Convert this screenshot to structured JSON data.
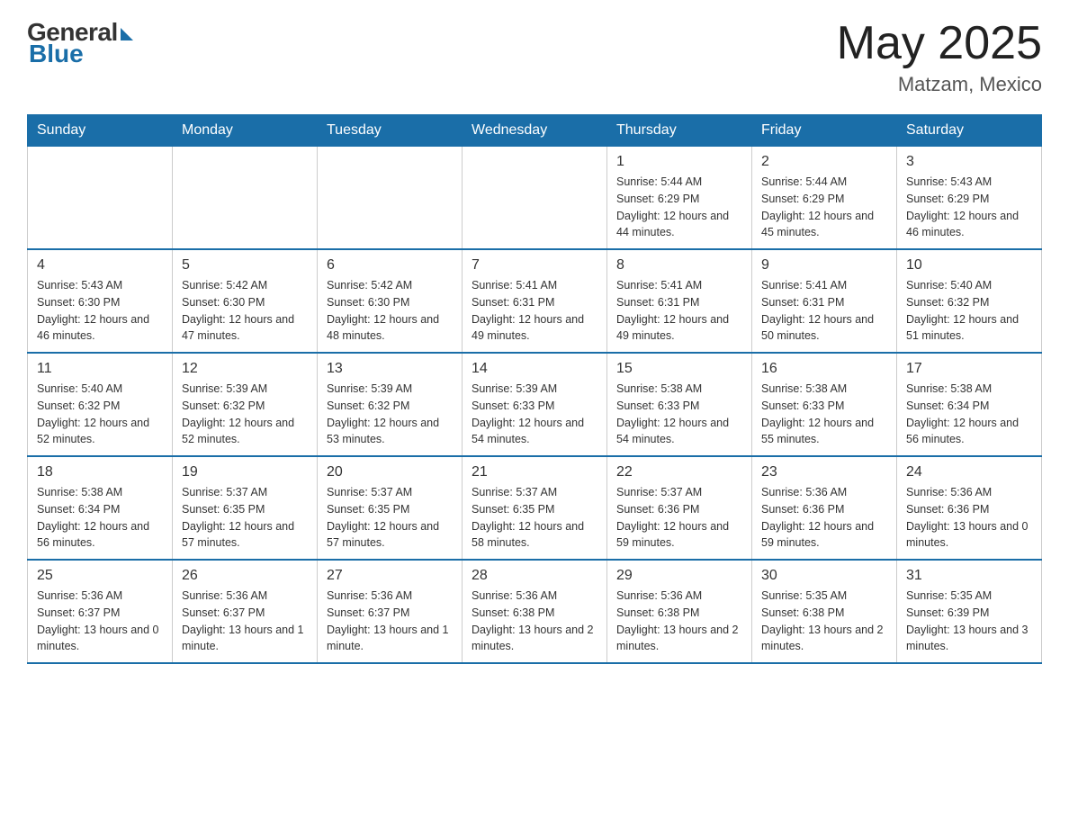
{
  "header": {
    "logo": {
      "general": "General",
      "blue": "Blue"
    },
    "title": "May 2025",
    "location": "Matzam, Mexico"
  },
  "days_of_week": [
    "Sunday",
    "Monday",
    "Tuesday",
    "Wednesday",
    "Thursday",
    "Friday",
    "Saturday"
  ],
  "weeks": [
    [
      {
        "day": "",
        "info": ""
      },
      {
        "day": "",
        "info": ""
      },
      {
        "day": "",
        "info": ""
      },
      {
        "day": "",
        "info": ""
      },
      {
        "day": "1",
        "info": "Sunrise: 5:44 AM\nSunset: 6:29 PM\nDaylight: 12 hours\nand 44 minutes."
      },
      {
        "day": "2",
        "info": "Sunrise: 5:44 AM\nSunset: 6:29 PM\nDaylight: 12 hours\nand 45 minutes."
      },
      {
        "day": "3",
        "info": "Sunrise: 5:43 AM\nSunset: 6:29 PM\nDaylight: 12 hours\nand 46 minutes."
      }
    ],
    [
      {
        "day": "4",
        "info": "Sunrise: 5:43 AM\nSunset: 6:30 PM\nDaylight: 12 hours\nand 46 minutes."
      },
      {
        "day": "5",
        "info": "Sunrise: 5:42 AM\nSunset: 6:30 PM\nDaylight: 12 hours\nand 47 minutes."
      },
      {
        "day": "6",
        "info": "Sunrise: 5:42 AM\nSunset: 6:30 PM\nDaylight: 12 hours\nand 48 minutes."
      },
      {
        "day": "7",
        "info": "Sunrise: 5:41 AM\nSunset: 6:31 PM\nDaylight: 12 hours\nand 49 minutes."
      },
      {
        "day": "8",
        "info": "Sunrise: 5:41 AM\nSunset: 6:31 PM\nDaylight: 12 hours\nand 49 minutes."
      },
      {
        "day": "9",
        "info": "Sunrise: 5:41 AM\nSunset: 6:31 PM\nDaylight: 12 hours\nand 50 minutes."
      },
      {
        "day": "10",
        "info": "Sunrise: 5:40 AM\nSunset: 6:32 PM\nDaylight: 12 hours\nand 51 minutes."
      }
    ],
    [
      {
        "day": "11",
        "info": "Sunrise: 5:40 AM\nSunset: 6:32 PM\nDaylight: 12 hours\nand 52 minutes."
      },
      {
        "day": "12",
        "info": "Sunrise: 5:39 AM\nSunset: 6:32 PM\nDaylight: 12 hours\nand 52 minutes."
      },
      {
        "day": "13",
        "info": "Sunrise: 5:39 AM\nSunset: 6:32 PM\nDaylight: 12 hours\nand 53 minutes."
      },
      {
        "day": "14",
        "info": "Sunrise: 5:39 AM\nSunset: 6:33 PM\nDaylight: 12 hours\nand 54 minutes."
      },
      {
        "day": "15",
        "info": "Sunrise: 5:38 AM\nSunset: 6:33 PM\nDaylight: 12 hours\nand 54 minutes."
      },
      {
        "day": "16",
        "info": "Sunrise: 5:38 AM\nSunset: 6:33 PM\nDaylight: 12 hours\nand 55 minutes."
      },
      {
        "day": "17",
        "info": "Sunrise: 5:38 AM\nSunset: 6:34 PM\nDaylight: 12 hours\nand 56 minutes."
      }
    ],
    [
      {
        "day": "18",
        "info": "Sunrise: 5:38 AM\nSunset: 6:34 PM\nDaylight: 12 hours\nand 56 minutes."
      },
      {
        "day": "19",
        "info": "Sunrise: 5:37 AM\nSunset: 6:35 PM\nDaylight: 12 hours\nand 57 minutes."
      },
      {
        "day": "20",
        "info": "Sunrise: 5:37 AM\nSunset: 6:35 PM\nDaylight: 12 hours\nand 57 minutes."
      },
      {
        "day": "21",
        "info": "Sunrise: 5:37 AM\nSunset: 6:35 PM\nDaylight: 12 hours\nand 58 minutes."
      },
      {
        "day": "22",
        "info": "Sunrise: 5:37 AM\nSunset: 6:36 PM\nDaylight: 12 hours\nand 59 minutes."
      },
      {
        "day": "23",
        "info": "Sunrise: 5:36 AM\nSunset: 6:36 PM\nDaylight: 12 hours\nand 59 minutes."
      },
      {
        "day": "24",
        "info": "Sunrise: 5:36 AM\nSunset: 6:36 PM\nDaylight: 13 hours\nand 0 minutes."
      }
    ],
    [
      {
        "day": "25",
        "info": "Sunrise: 5:36 AM\nSunset: 6:37 PM\nDaylight: 13 hours\nand 0 minutes."
      },
      {
        "day": "26",
        "info": "Sunrise: 5:36 AM\nSunset: 6:37 PM\nDaylight: 13 hours\nand 1 minute."
      },
      {
        "day": "27",
        "info": "Sunrise: 5:36 AM\nSunset: 6:37 PM\nDaylight: 13 hours\nand 1 minute."
      },
      {
        "day": "28",
        "info": "Sunrise: 5:36 AM\nSunset: 6:38 PM\nDaylight: 13 hours\nand 2 minutes."
      },
      {
        "day": "29",
        "info": "Sunrise: 5:36 AM\nSunset: 6:38 PM\nDaylight: 13 hours\nand 2 minutes."
      },
      {
        "day": "30",
        "info": "Sunrise: 5:35 AM\nSunset: 6:38 PM\nDaylight: 13 hours\nand 2 minutes."
      },
      {
        "day": "31",
        "info": "Sunrise: 5:35 AM\nSunset: 6:39 PM\nDaylight: 13 hours\nand 3 minutes."
      }
    ]
  ]
}
